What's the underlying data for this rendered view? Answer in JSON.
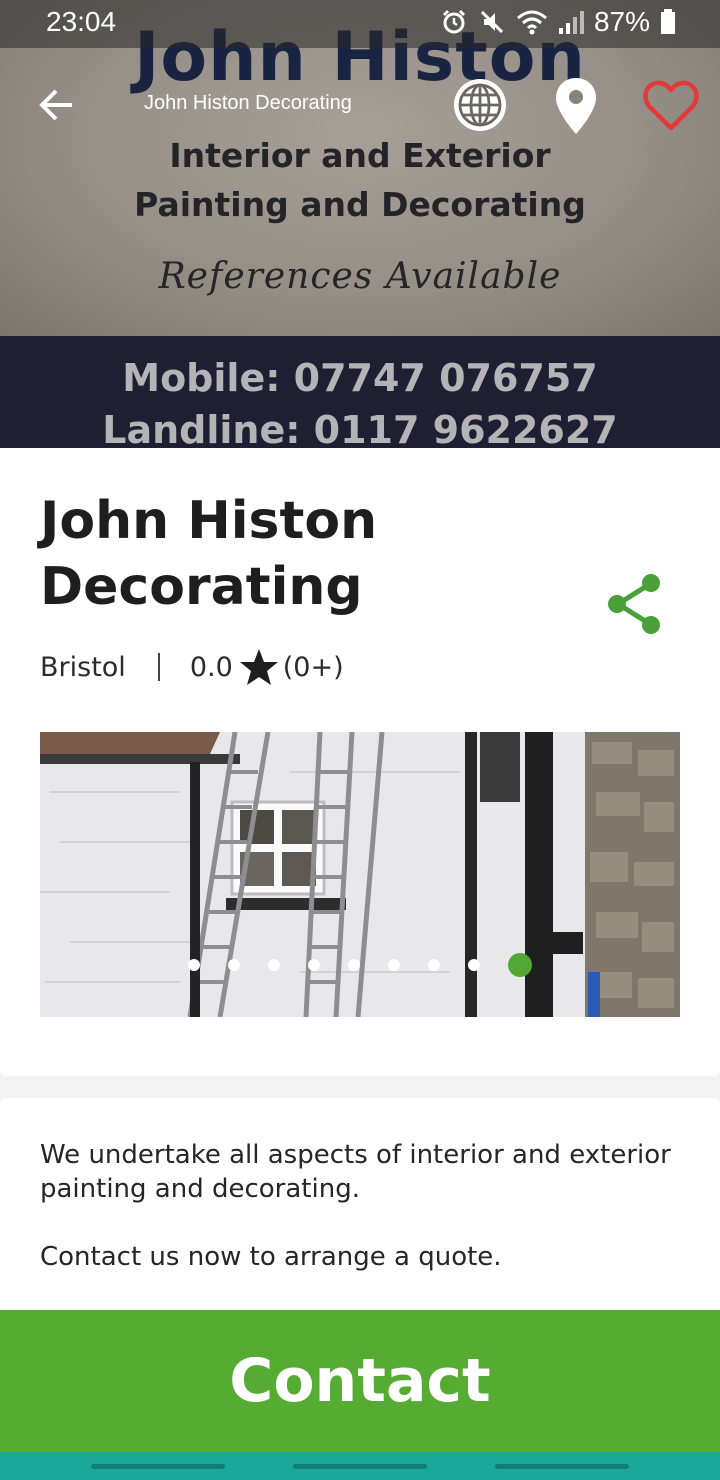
{
  "status_bar": {
    "time": "23:04",
    "battery": "87%"
  },
  "hero": {
    "sign_name": "John Histon",
    "sign_line1": "Interior and Exterior",
    "sign_line2": "Painting and Decorating",
    "sign_references": "References Available",
    "sign_mobile": "Mobile: 07747 076757",
    "sign_landline": "Landline: 0117 9622627"
  },
  "toolbar": {
    "title": "John Histon Decorating",
    "icons": [
      "back-arrow-icon",
      "globe-icon",
      "map-pin-icon",
      "heart-icon"
    ]
  },
  "business": {
    "name": "John Histon Decorating",
    "location": "Bristol",
    "rating": "0.0",
    "review_count": "(0+)"
  },
  "gallery": {
    "image_count": 9,
    "active_index": 8
  },
  "description": {
    "paragraph1": "We undertake all aspects of interior and exterior painting and decorating.",
    "paragraph2": "Contact us now to arrange a quote."
  },
  "contact": {
    "label": "Contact"
  },
  "colors": {
    "accent_green": "#56ab32",
    "favorite_red": "#e53935",
    "nav_teal": "#1aa89a"
  }
}
